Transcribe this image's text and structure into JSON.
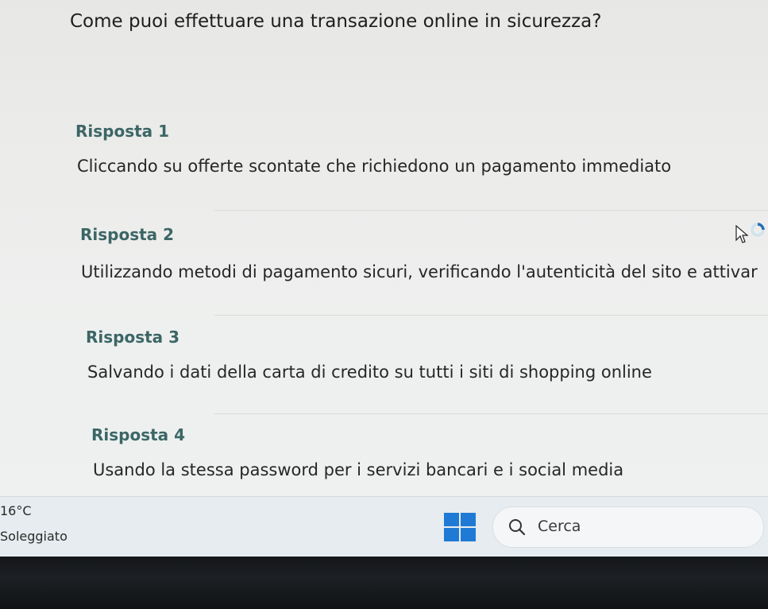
{
  "question": "Come puoi effettuare una transazione online in sicurezza?",
  "answers": [
    {
      "label": "Risposta 1",
      "text": "Cliccando su offerte scontate che richiedono un pagamento immediato"
    },
    {
      "label": "Risposta 2",
      "text": "Utilizzando metodi di pagamento sicuri, verificando l'autenticità del sito e attivar"
    },
    {
      "label": "Risposta 3",
      "text": "Salvando i dati della carta di credito su tutti i siti di shopping online"
    },
    {
      "label": "Risposta 4",
      "text": "Usando la stessa password per i servizi bancari e i social media"
    }
  ],
  "taskbar": {
    "weather": {
      "temperature": "16°C",
      "condition": "Soleggiato"
    },
    "search": {
      "label": "Cerca"
    }
  },
  "colors": {
    "label": "#3c6666",
    "text": "#262626",
    "windows_blue": "#1f7ad6"
  },
  "icons": [
    "windows-start-icon",
    "search-icon",
    "pointer-busy-icon"
  ]
}
